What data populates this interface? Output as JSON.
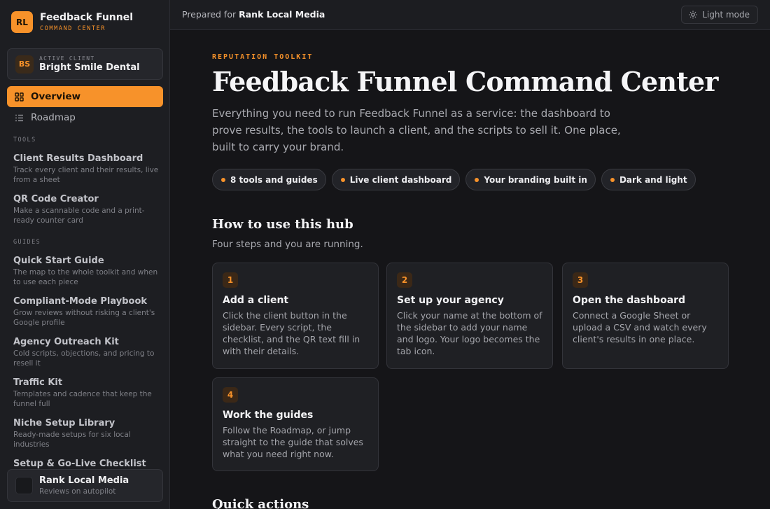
{
  "brand": {
    "initials": "RL",
    "name": "Feedback Funnel",
    "subtitle": "COMMAND CENTER"
  },
  "active_client": {
    "label": "ACTIVE CLIENT",
    "initials": "BS",
    "name": "Bright Smile Dental"
  },
  "nav": [
    {
      "label": "Overview",
      "icon": "grid-icon",
      "active": true
    },
    {
      "label": "Roadmap",
      "icon": "list-icon",
      "active": false
    }
  ],
  "sections": {
    "tools_label": "TOOLS",
    "guides_label": "GUIDES"
  },
  "tools": [
    {
      "title": "Client Results Dashboard",
      "desc": "Track every client and their results, live from a sheet"
    },
    {
      "title": "QR Code Creator",
      "desc": "Make a scannable code and a print-ready counter card"
    }
  ],
  "guides": [
    {
      "title": "Quick Start Guide",
      "desc": "The map to the whole toolkit and when to use each piece"
    },
    {
      "title": "Compliant-Mode Playbook",
      "desc": "Grow reviews without risking a client's Google profile"
    },
    {
      "title": "Agency Outreach Kit",
      "desc": "Cold scripts, objections, and pricing to resell it"
    },
    {
      "title": "Traffic Kit",
      "desc": "Templates and cadence that keep the funnel full"
    },
    {
      "title": "Niche Setup Library",
      "desc": "Ready-made setups for six local industries"
    },
    {
      "title": "Setup & Go-Live Checklist",
      "desc": ""
    }
  ],
  "agency": {
    "name": "Rank Local Media",
    "tagline": "Reviews on autopilot"
  },
  "topbar": {
    "prepared_prefix": "Prepared for",
    "prepared_name": "Rank Local Media",
    "mode_label": "Light mode",
    "mode_icon": "sun-icon"
  },
  "hero": {
    "eyebrow": "REPUTATION TOOLKIT",
    "title": "Feedback Funnel Command Center",
    "description": "Everything you need to run Feedback Funnel as a service: the dashboard to prove results, the tools to launch a client, and the scripts to sell it. One place, built to carry your brand.",
    "pills": [
      "8 tools and guides",
      "Live client dashboard",
      "Your branding built in",
      "Dark and light"
    ]
  },
  "how_to": {
    "title": "How to use this hub",
    "subtitle": "Four steps and you are running.",
    "steps": [
      {
        "num": "1",
        "title": "Add a client",
        "body": "Click the client button in the sidebar. Every script, the checklist, and the QR text fill in with their details."
      },
      {
        "num": "2",
        "title": "Set up your agency",
        "body": "Click your name at the bottom of the sidebar to add your name and logo. Your logo becomes the tab icon."
      },
      {
        "num": "3",
        "title": "Open the dashboard",
        "body": "Connect a Google Sheet or upload a CSV and watch every client's results in one place."
      },
      {
        "num": "4",
        "title": "Work the guides",
        "body": "Follow the Roadmap, or jump straight to the guide that solves what you need right now."
      }
    ]
  },
  "quick_actions": {
    "title": "Quick actions"
  },
  "colors": {
    "accent": "#f7922a",
    "background": "#151518",
    "sidebar": "#1d1e22"
  }
}
